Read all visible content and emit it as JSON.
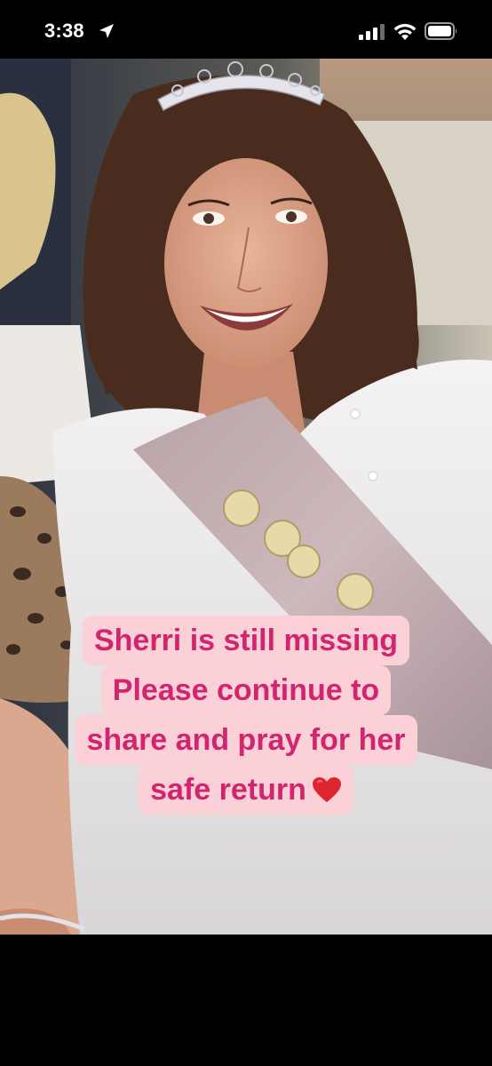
{
  "status_bar": {
    "time": "3:38",
    "icons": [
      "location-arrow-icon",
      "cellular-signal-icon",
      "wifi-icon",
      "battery-icon"
    ]
  },
  "story": {
    "image_description_icon": "photo",
    "caption_lines": [
      "Sherri is still missing",
      "Please continue to",
      "share and pray for her",
      "safe return"
    ],
    "caption_emoji_icon": "red-heart-icon",
    "colors": {
      "caption_text": "#d1256f",
      "caption_background": "#fbd0d6",
      "heart": "#e0242f"
    }
  }
}
